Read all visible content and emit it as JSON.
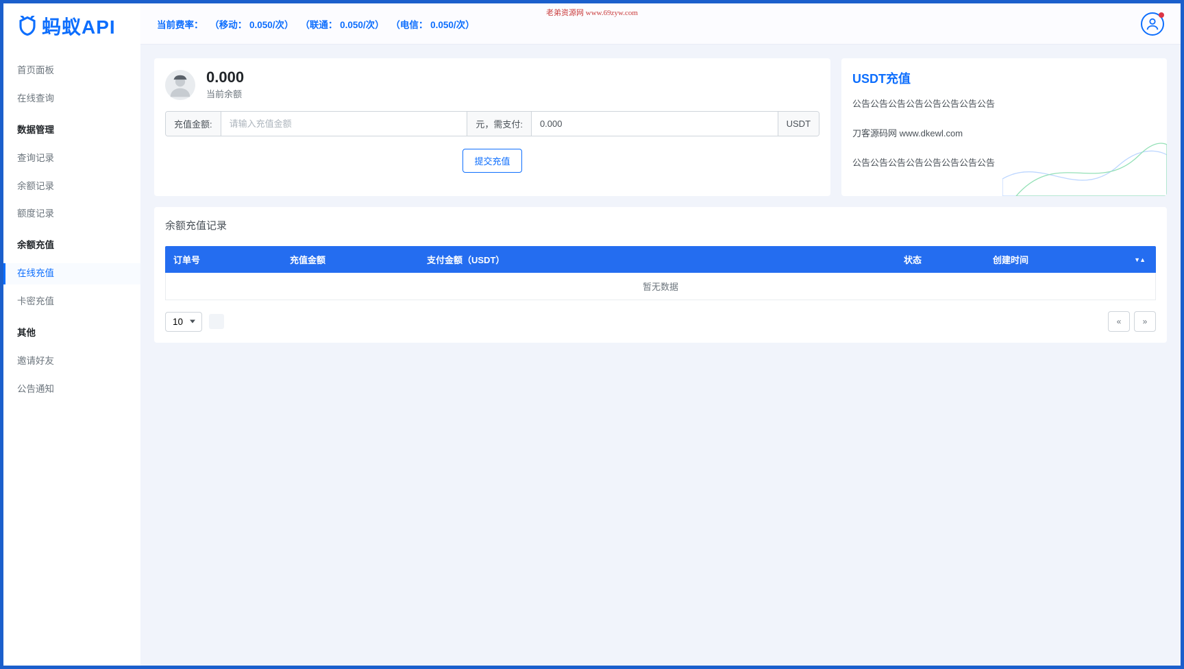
{
  "watermark": "老弟资源网  www.69zyw.com",
  "logo_text": "蚂蚁API",
  "sidebar": {
    "items": [
      {
        "label": "首页面板",
        "type": "item"
      },
      {
        "label": "在线查询",
        "type": "item"
      },
      {
        "label": "数据管理",
        "type": "header"
      },
      {
        "label": "查询记录",
        "type": "item"
      },
      {
        "label": "余额记录",
        "type": "item"
      },
      {
        "label": "额度记录",
        "type": "item"
      },
      {
        "label": "余额充值",
        "type": "header"
      },
      {
        "label": "在线充值",
        "type": "item",
        "active": true
      },
      {
        "label": "卡密充值",
        "type": "item"
      },
      {
        "label": "其他",
        "type": "header"
      },
      {
        "label": "邀请好友",
        "type": "item"
      },
      {
        "label": "公告通知",
        "type": "item"
      }
    ]
  },
  "topbar": {
    "label": "当前费率：",
    "rate_mobile": "（移动： 0.050/次）",
    "rate_unicom": "（联通： 0.050/次）",
    "rate_telecom": "（电信： 0.050/次）"
  },
  "balance": {
    "value": "0.000",
    "label": "当前余额"
  },
  "recharge_form": {
    "amount_label": "充值金额:",
    "amount_placeholder": "请输入充值金额",
    "unit_label": "元，需支付:",
    "pay_value": "0.000",
    "currency_label": "USDT",
    "submit_label": "提交充值"
  },
  "usdt_panel": {
    "title": "USDT充值",
    "notice1": "公告公告公告公告公告公告公告公告",
    "notice2": "刀客源码网 www.dkewl.com",
    "notice3": "公告公告公告公告公告公告公告公告"
  },
  "records": {
    "title": "余额充值记录",
    "columns": {
      "order": "订单号",
      "amount": "充值金额",
      "pay": "支付金额（USDT）",
      "status": "状态",
      "time": "创建时间"
    },
    "empty": "暂无数据"
  },
  "pagination": {
    "page_size": "10",
    "prev": "«",
    "next": "»"
  }
}
